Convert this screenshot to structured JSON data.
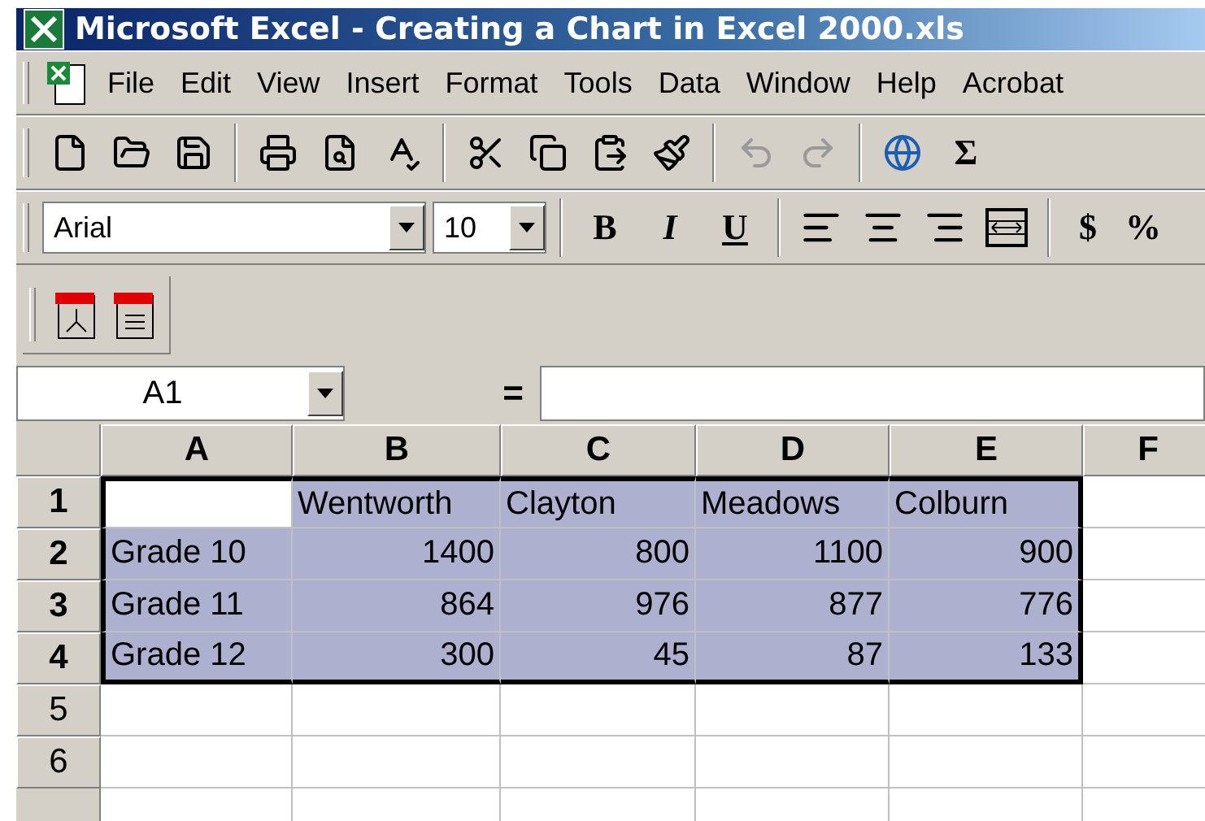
{
  "window": {
    "title": "Microsoft Excel - Creating a Chart in Excel 2000.xls"
  },
  "menu": [
    "File",
    "Edit",
    "View",
    "Insert",
    "Format",
    "Tools",
    "Data",
    "Window",
    "Help",
    "Acrobat"
  ],
  "standard_toolbar": {
    "undo_disabled": true,
    "redo_disabled": true,
    "autosum": "Σ"
  },
  "formatting_toolbar": {
    "font": "Arial",
    "size": "10",
    "bold": "B",
    "italic": "I",
    "underline": "U",
    "currency": "$",
    "percent": "%"
  },
  "formula_bar": {
    "name_box": "A1",
    "equals": "="
  },
  "sheet": {
    "columns": [
      "A",
      "B",
      "C",
      "D",
      "E",
      "F"
    ],
    "rows": [
      {
        "header": "1",
        "cells": [
          {
            "active": true
          },
          {
            "text": "Wentworth",
            "selected": true
          },
          {
            "text": "Clayton",
            "selected": true
          },
          {
            "text": "Meadows",
            "selected": true
          },
          {
            "text": "Colburn",
            "selected": true
          },
          {
            "selected": false
          }
        ]
      },
      {
        "header": "2",
        "cells": [
          {
            "text": "Grade 10",
            "selected": true
          },
          {
            "text": "1400",
            "selected": true,
            "numeric": true
          },
          {
            "text": "800",
            "selected": true,
            "numeric": true
          },
          {
            "text": "1100",
            "selected": true,
            "numeric": true
          },
          {
            "text": "900",
            "selected": true,
            "numeric": true
          },
          {
            "selected": false
          }
        ]
      },
      {
        "header": "3",
        "cells": [
          {
            "text": "Grade 11",
            "selected": true
          },
          {
            "text": "864",
            "selected": true,
            "numeric": true
          },
          {
            "text": "976",
            "selected": true,
            "numeric": true
          },
          {
            "text": "877",
            "selected": true,
            "numeric": true
          },
          {
            "text": "776",
            "selected": true,
            "numeric": true
          },
          {
            "selected": false
          }
        ]
      },
      {
        "header": "4",
        "cells": [
          {
            "text": "Grade 12",
            "selected": true
          },
          {
            "text": "300",
            "selected": true,
            "numeric": true
          },
          {
            "text": "45",
            "selected": true,
            "numeric": true
          },
          {
            "text": "87",
            "selected": true,
            "numeric": true
          },
          {
            "text": "133",
            "selected": true,
            "numeric": true
          },
          {
            "selected": false
          }
        ]
      },
      {
        "header": "5",
        "cells": [
          {
            "selected": false
          },
          {
            "selected": false
          },
          {
            "selected": false
          },
          {
            "selected": false
          },
          {
            "selected": false
          },
          {
            "selected": false
          }
        ]
      },
      {
        "header": "6",
        "cells": [
          {
            "selected": false
          },
          {
            "selected": false
          },
          {
            "selected": false
          },
          {
            "selected": false
          },
          {
            "selected": false
          },
          {
            "selected": false
          }
        ]
      }
    ]
  }
}
